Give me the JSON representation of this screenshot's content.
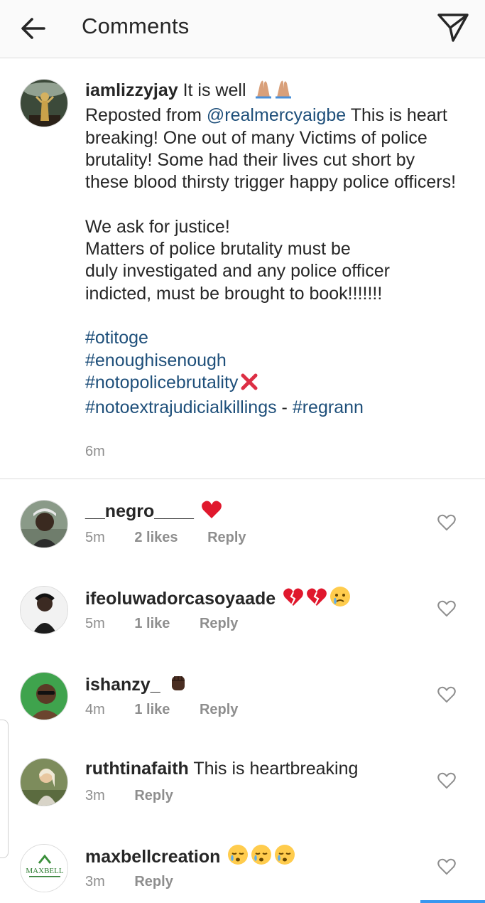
{
  "header": {
    "title": "Comments",
    "back_icon": "arrow-left-icon",
    "send_icon": "paper-plane-icon"
  },
  "post": {
    "username": "iamlizzyjay",
    "text_intro": "It is well",
    "reposted_prefix": "Reposted from",
    "mention": "@realmercyaigbe",
    "body_1": "This is heart breaking! One out of many Victims of police brutality! Some had their lives cut short by these blood thirsty trigger happy police officers!",
    "body_2_line1": "We ask for justice!",
    "body_2_line2": "Matters of police brutality must be",
    "body_2_line3": "duly investigated and any police officer",
    "body_2_line4": "indicted, must be brought to book!!!!!!!",
    "hashtags": [
      "#otitoge",
      "#enoughisenough",
      "#notopolicebrutality",
      "#notoextrajudicialkillings"
    ],
    "separator": "-",
    "final_tag": "#regrann",
    "time": "6m"
  },
  "comments": [
    {
      "username": "__negro____",
      "text": "",
      "time": "5m",
      "likes": "2 likes",
      "reply": "Reply"
    },
    {
      "username": "ifeoluwadorcasoyaade",
      "text": "",
      "time": "5m",
      "likes": "1 like",
      "reply": "Reply"
    },
    {
      "username": "ishanzy_",
      "text": "",
      "time": "4m",
      "likes": "1 like",
      "reply": "Reply"
    },
    {
      "username": "ruthtinafaith",
      "text": "This is heartbreaking",
      "time": "3m",
      "likes": "",
      "reply": "Reply"
    },
    {
      "username": "maxbellcreation",
      "text": "",
      "time": "3m",
      "likes": "",
      "reply": "Reply"
    }
  ],
  "avatar_texts": {
    "maxbell": "MAXBELL"
  },
  "colors": {
    "link": "#1e4f7a",
    "muted": "#8e8e8e",
    "text": "#262626",
    "accent": "#3897f0"
  }
}
